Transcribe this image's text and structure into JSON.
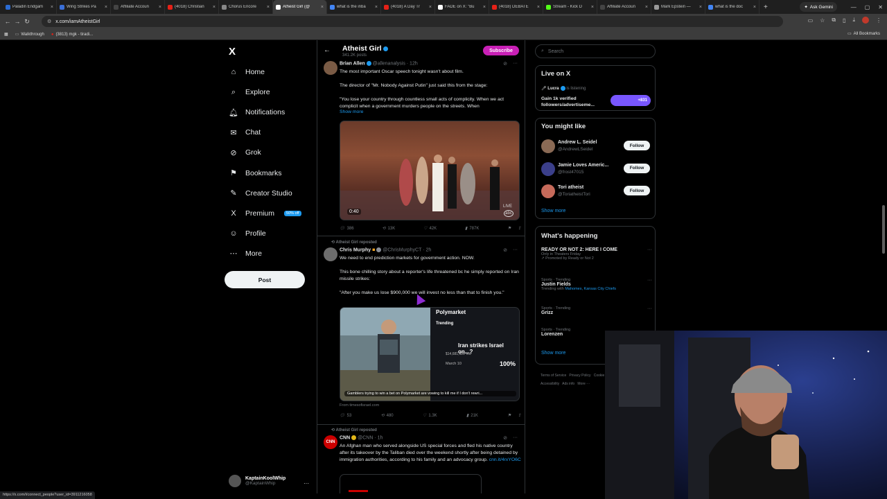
{
  "browser": {
    "tabs": [
      {
        "label": "Paladin Endgam",
        "color": "#2b6cd4"
      },
      {
        "label": "Wing Strikes Pa",
        "color": "#3a6fd8"
      },
      {
        "label": "Affiliate Accoun",
        "color": "#444444"
      },
      {
        "label": "(4018) Christian",
        "color": "#e62117"
      },
      {
        "label": "Chorus Encore",
        "color": "#888888"
      },
      {
        "label": "Atheist Girl (@",
        "color": "#ffffff"
      },
      {
        "label": "what is the inba",
        "color": "#4285f4"
      },
      {
        "label": "(4018) A Day Tr",
        "color": "#e62117"
      },
      {
        "label": "FADE on X: \"Bu",
        "color": "#ffffff"
      },
      {
        "label": "(4018) DEBATE",
        "color": "#e62117"
      },
      {
        "label": "Stream - Kick D",
        "color": "#53fc18"
      },
      {
        "label": "Affiliate Accoun",
        "color": "#444444"
      },
      {
        "label": "Mark Epstein —",
        "color": "#999999"
      },
      {
        "label": "what is the doc",
        "color": "#4285f4"
      }
    ],
    "active_tab": 5,
    "new_tab_icon": "plus-icon",
    "gemini_label": "Ask Gemini",
    "url": "x.com/iamAtheistGirl",
    "bookmarks": [
      {
        "label": "Walkthrough"
      },
      {
        "label": "(3813) mgk - tiradi..."
      }
    ],
    "all_bookmarks": "All Bookmarks",
    "status_url": "https://x.com/i/connect_people?user_id=3911216058"
  },
  "nav": {
    "logo": "X",
    "items": [
      {
        "label": "Home",
        "icon": "home-icon",
        "glyph": "⌂"
      },
      {
        "label": "Explore",
        "icon": "search-icon",
        "glyph": "⌕"
      },
      {
        "label": "Notifications",
        "icon": "bell-icon",
        "glyph": "🔔︎"
      },
      {
        "label": "Chat",
        "icon": "mail-icon",
        "glyph": "✉"
      },
      {
        "label": "Grok",
        "icon": "grok-icon",
        "glyph": "⊘"
      },
      {
        "label": "Bookmarks",
        "icon": "bookmark-icon",
        "glyph": "⚑"
      },
      {
        "label": "Creator Studio",
        "icon": "creator-icon",
        "glyph": "✎"
      },
      {
        "label": "Premium",
        "icon": "premium-icon",
        "glyph": "X",
        "badge": "50% off"
      },
      {
        "label": "Profile",
        "icon": "profile-icon",
        "glyph": "☺"
      },
      {
        "label": "More",
        "icon": "more-icon",
        "glyph": "⋯"
      }
    ],
    "post_button": "Post",
    "account": {
      "name": "KaptainKoolWhip",
      "handle": "@KaptainWhip",
      "more": "···"
    }
  },
  "profile_header": {
    "name": "Atheist Girl",
    "post_count": "341.2K posts",
    "subscribe": "Subscribe"
  },
  "posts": [
    {
      "author": "Brian Allen",
      "handle": "@allenanalysis · 12h",
      "paragraphs": [
        "The most important Oscar speech tonight wasn't about film.",
        "The director of \"Mr. Nobody Against Putin\" just said this from the stage:",
        "\"You lose your country through countless small acts of complicity. When we act complicit when a government murders people on the streets. When"
      ],
      "show_more": "Show more",
      "video_time": "0:40",
      "video_tag": "LIVE",
      "video_network": "abc",
      "stats": {
        "replies": "386",
        "reposts": "13K",
        "likes": "42K",
        "views": "787K"
      }
    },
    {
      "repost_by": "Atheist Girl reposted",
      "author": "Chris Murphy",
      "handle": "@ChrisMurphyCT · 2h",
      "paragraphs": [
        "We need to end prediction markets for government action. NOW.",
        "This bone chilling story about a reporter's life threatened bc he simply reported on Iran missile strikes:",
        "\"After you make us lose $900,000 we will invest no less than that to finish you.\""
      ],
      "card": {
        "brand": "Polymarket",
        "trending": "Trending",
        "headline": "Iran strikes Israel on...?",
        "date": "March 10",
        "percent": "100%",
        "amount": "$14,681,920 Vol.",
        "caption": "Gamblers trying to win a bet on Polymarket are vowing to kill me if I don't rewri...",
        "source": "From timesofisrael.com"
      },
      "stats": {
        "replies": "53",
        "reposts": "480",
        "likes": "1.3K",
        "views": "21K"
      }
    },
    {
      "repost_by": "Atheist Girl reposted",
      "author": "CNN",
      "handle": "@CNN · 1h",
      "text": "An Afghan man who served alongside US special forces and fled his native country after its takeover by the Taliban died over the weekend shortly after being detained by immigration authorities, according to his family and an advocacy group.",
      "link": "cnn.it/4rxYO6C"
    }
  ],
  "right": {
    "search_placeholder": "Search",
    "live": {
      "title": "Live on X",
      "host": "Lucra",
      "status": "is listening",
      "headline": "Gain 1k verified followers/advertiseme...",
      "count": "+831"
    },
    "who_to_follow": {
      "title": "You might like",
      "users": [
        {
          "name": "Andrew L. Seidel",
          "handle": "@AndrewLSeidel",
          "button": "Follow",
          "color": "#8a6a55"
        },
        {
          "name": "Jamie Loves Americ...",
          "handle": "@frost47015",
          "button": "Follow",
          "color": "#3b3f8a"
        },
        {
          "name": "Tori atheist",
          "handle": "@ToriatheistTori",
          "button": "Follow",
          "color": "#c66a5a"
        }
      ],
      "show_more": "Show more"
    },
    "happening": {
      "title": "What's happening",
      "trends": [
        {
          "name": "READY OR NOT 2: HERE I COME",
          "meta": "Only in Theaters Friday",
          "sub": "Promoted by Ready or Not 2"
        },
        {
          "meta": "Sports · Trending",
          "name": "Justin Fields",
          "sub": "Trending with",
          "links": "Mahomes, Kansas City Chiefs"
        },
        {
          "meta": "Sports · Trending",
          "name": "Grizz"
        },
        {
          "meta": "Sports · Trending",
          "name": "Lorenzen"
        }
      ],
      "show_more": "Show more"
    },
    "footer": [
      "Terms of Service",
      "Privacy Policy",
      "Cookie Policy",
      "Accessibility",
      "Ads info",
      "More ···"
    ]
  },
  "colors": {
    "accent": "#1d9bf0",
    "subscribe": "#c920b6",
    "border": "#2f3336",
    "muted": "#71767b"
  }
}
